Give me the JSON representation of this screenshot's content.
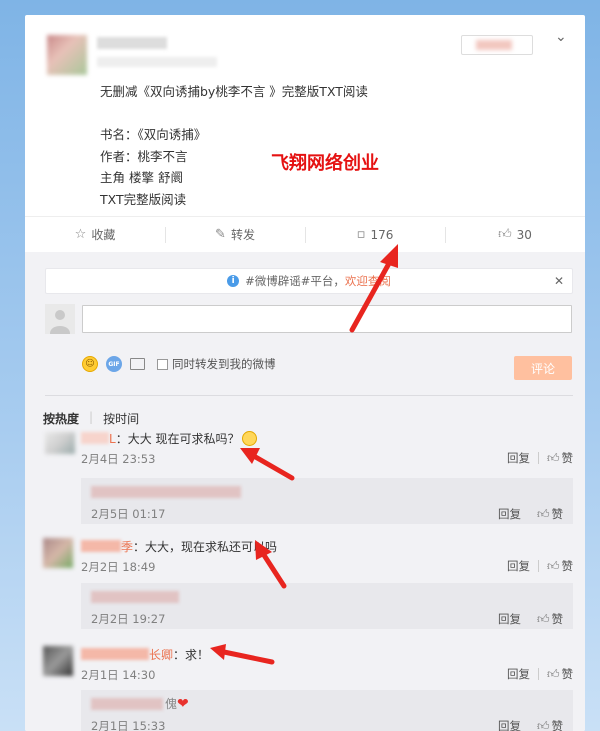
{
  "post": {
    "title_line": "无删减《双向诱捕by桃李不言 》完整版TXT阅读",
    "book_line": "书名：《双向诱捕》",
    "author_line": "作者：桃李不言",
    "leads_line": "主角 楼擎 舒阛",
    "txt_line": "TXT完整版阅读",
    "watermark": "飞翔网络创业"
  },
  "actions": {
    "favorite_label": "收藏",
    "repost_label": "转发",
    "comment_count": "176",
    "like_count": "30"
  },
  "notice": {
    "prefix": "#微博辟谣#平台，",
    "link": "欢迎查阅"
  },
  "composer": {
    "sync_label": "同时转发到我的微博",
    "submit_label": "评论"
  },
  "sort": {
    "by_hot": "按热度",
    "by_time": "按时间"
  },
  "ops": {
    "reply": "回复",
    "like": "赞"
  },
  "comments": [
    {
      "name_suffix": "L",
      "text": "：大大 现在可求私吗？",
      "time": "2月4日 23:53",
      "reply": {
        "time": "2月5日 01:17"
      }
    },
    {
      "name_suffix": "季",
      "text": "：大大，现在求私还可以吗",
      "time": "2月2日 18:49",
      "reply": {
        "time": "2月2日 19:27"
      }
    },
    {
      "name_suffix": "长卿",
      "text": "：求！",
      "time": "2月1日 14:30",
      "reply": {
        "suffix": "傀",
        "time": "2月1日 15:33"
      }
    }
  ],
  "colors": {
    "accent_orange": "#eb7350",
    "watermark_red": "#e51212",
    "arrow_red": "#e8251f",
    "submit_bg": "#ffc09f",
    "background_blue": "#7fb4e6"
  }
}
